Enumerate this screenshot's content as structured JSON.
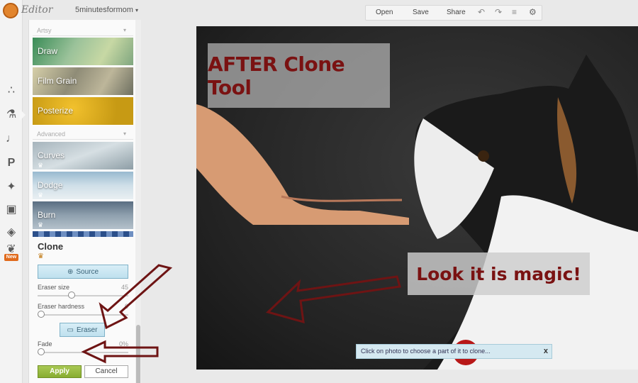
{
  "app": {
    "logo_text": "Editor",
    "account": "5minutesformom"
  },
  "rail": {
    "new_badge": "New"
  },
  "panel": {
    "section_artsy": "Artsy",
    "section_advanced": "Advanced",
    "effects_artsy": [
      {
        "label": "Draw"
      },
      {
        "label": "Film Grain"
      },
      {
        "label": "Posterize"
      }
    ],
    "effects_advanced": [
      {
        "label": "Curves"
      },
      {
        "label": "Dodge"
      },
      {
        "label": "Burn"
      }
    ],
    "clone": {
      "title": "Clone",
      "source_label": "Source",
      "eraser_size_label": "Eraser size",
      "eraser_size_value": 45,
      "eraser_hardness_label": "Eraser hardness",
      "eraser_hardness_value": 0,
      "eraser_label": "Eraser",
      "fade_label": "Fade",
      "fade_value": "0%",
      "fade_level": 0,
      "apply_label": "Apply",
      "cancel_label": "Cancel"
    }
  },
  "toolbar": {
    "open_label": "Open",
    "save_label": "Save",
    "share_label": "Share",
    "icons": [
      "undo-icon",
      "redo-icon",
      "layers-icon",
      "gear-icon"
    ]
  },
  "canvas": {
    "overlay_title": "AFTER Clone Tool",
    "overlay_magic": "Look it is magic!",
    "hint": "Click on photo to choose a part of it to clone...",
    "hint_close": "x"
  },
  "colors": {
    "accent_red": "#7a1212",
    "apply_green": "#88ad31",
    "toggle_blue": "#bfe0ee",
    "hint_bg": "#d5e9f1"
  }
}
